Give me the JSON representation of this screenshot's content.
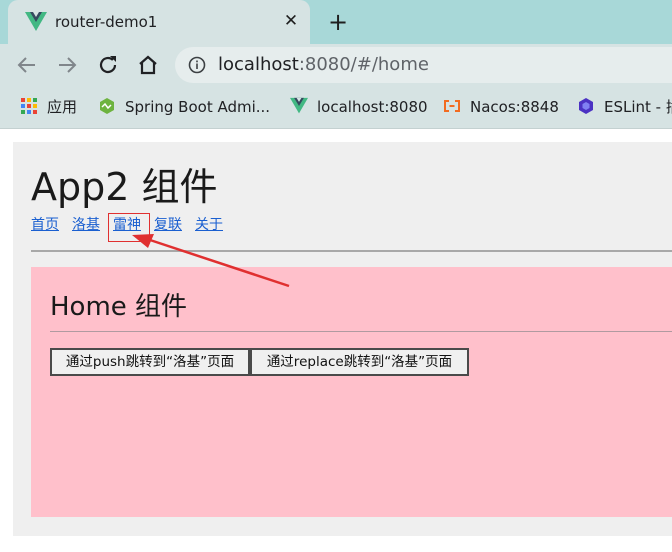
{
  "tab": {
    "title": "router-demo1",
    "close": "✕"
  },
  "toolbar": {
    "new_tab": "+",
    "url_host": "localhost",
    "url_rest": ":8080/#/home"
  },
  "bookmarks": [
    {
      "label": "应用",
      "icon": "apps-grid-icon"
    },
    {
      "label": "Spring Boot Admi...",
      "icon": "spring-boot-admin-icon"
    },
    {
      "label": "localhost:8080",
      "icon": "vue-logo-icon"
    },
    {
      "label": "Nacos:8848",
      "icon": "nacos-icon"
    },
    {
      "label": "ESLint - 插",
      "icon": "eslint-icon"
    }
  ],
  "page": {
    "app_title": "App2 组件",
    "nav": [
      "首页",
      "洛基",
      "雷神",
      "复联",
      "关于"
    ],
    "home_title": "Home 组件",
    "buttons": {
      "push": "通过push跳转到“洛基”页面",
      "replace": "通过replace跳转到“洛基”页面"
    }
  },
  "colors": {
    "accent_annotation": "#e03030",
    "panel_bg": "#ffc0cb",
    "link": "#1a5fd0",
    "vue_green": "#42b883"
  }
}
